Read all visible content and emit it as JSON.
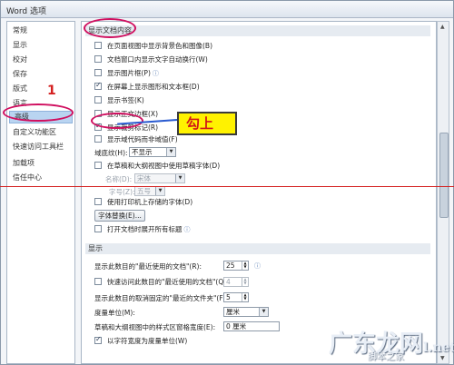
{
  "window": {
    "title": "Word 选项"
  },
  "sidebar": {
    "items": [
      {
        "label": "常规"
      },
      {
        "label": "显示"
      },
      {
        "label": "校对"
      },
      {
        "label": "保存"
      },
      {
        "label": "版式"
      },
      {
        "label": "语言"
      },
      {
        "label": "高级",
        "selected": true
      },
      {
        "label": "自定义功能区"
      },
      {
        "label": "快速访问工具栏"
      },
      {
        "label": "加载项"
      },
      {
        "label": "信任中心"
      }
    ]
  },
  "doc_content": {
    "heading": "显示文档内容",
    "options": [
      {
        "label": "在页面视图中显示背景色和图像(B)",
        "checked": false
      },
      {
        "label": "文档窗口内显示文字自动换行(W)",
        "checked": false
      },
      {
        "label": "显示图片框(P)",
        "checked": false,
        "info": true
      },
      {
        "label": "在屏幕上显示图形和文本框(D)",
        "checked": true
      },
      {
        "label": "显示书签(K)",
        "checked": false
      },
      {
        "label": "显示正文边框(X)",
        "checked": false
      },
      {
        "label": "显示裁剪标记(R)",
        "checked": true
      },
      {
        "label": "显示域代码而非域值(F)",
        "checked": false
      }
    ],
    "field_shading_label": "域底纹(H):",
    "field_shading_value": "不显示",
    "draft_font_option": "在草稿和大纲视图中使用草稿字体(D)",
    "font_name_label": "名称(D):",
    "font_name_value": "宋体",
    "font_size_label": "字号(Z):",
    "font_size_value": "五号",
    "printer_fonts_option": "使用打印机上存储的字体(D)",
    "font_substitution_button": "字体替换(E)...",
    "tracking_option": "打开文档时展开所有标题",
    "tracking_info": true
  },
  "display": {
    "heading": "显示",
    "recent_docs_label": "显示此数目的\"最近使用的文档\"(R):",
    "recent_docs_value": "25",
    "quick_access_label": "快速访问此数目的\"最近使用的文档\"(Q):",
    "quick_access_value": "4",
    "unpinned_folders_label": "显示此数目的取消固定的\"最近的文件夹\"(F):",
    "unpinned_folders_value": "5",
    "units_label": "度量单位(M):",
    "units_value": "厘米",
    "style_area_label": "草稿和大纲视图中的样式区窗格宽度(E):",
    "style_area_value": "0 厘米",
    "char_width_option": "以字符宽度为度量单位(W)",
    "char_width_checked": true
  },
  "annotations": {
    "mark_one": "1",
    "callout": "勾上"
  },
  "watermark": {
    "brand": "广东龙网",
    "brand_suffix": "l.net",
    "sub": "脚本之家"
  },
  "colors": {
    "annotation_red": "#d42020",
    "callout_yellow": "#fff200",
    "selection_blue": "#b9d4f1"
  }
}
